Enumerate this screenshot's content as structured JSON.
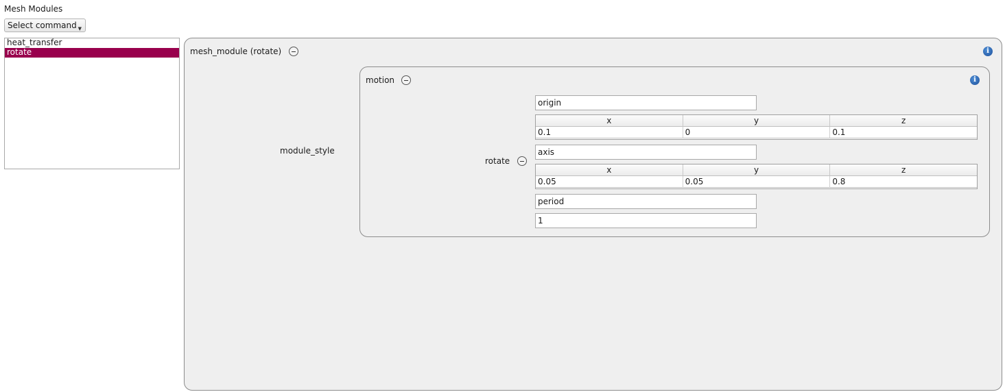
{
  "panel": {
    "title": "Mesh Modules",
    "command_select": "Select command"
  },
  "module_list": {
    "items": [
      {
        "label": "heat_transfer",
        "selected": false
      },
      {
        "label": "rotate",
        "selected": true
      }
    ],
    "selected_color": "#99004d"
  },
  "editor": {
    "group_title": "mesh_module (rotate)",
    "module_style_label": "module_style",
    "motion": {
      "title": "motion",
      "rotate_label": "rotate",
      "origin": {
        "field": "origin",
        "headers": [
          "x",
          "y",
          "z"
        ],
        "values": [
          "0.1",
          "0",
          "0.1"
        ]
      },
      "axis": {
        "field": "axis",
        "headers": [
          "x",
          "y",
          "z"
        ],
        "values": [
          "0.05",
          "0.05",
          "0.8"
        ]
      },
      "period": {
        "field": "period",
        "value": "1"
      }
    }
  },
  "icons": {
    "collapse": "minus-circle-icon",
    "info": "info-icon"
  }
}
